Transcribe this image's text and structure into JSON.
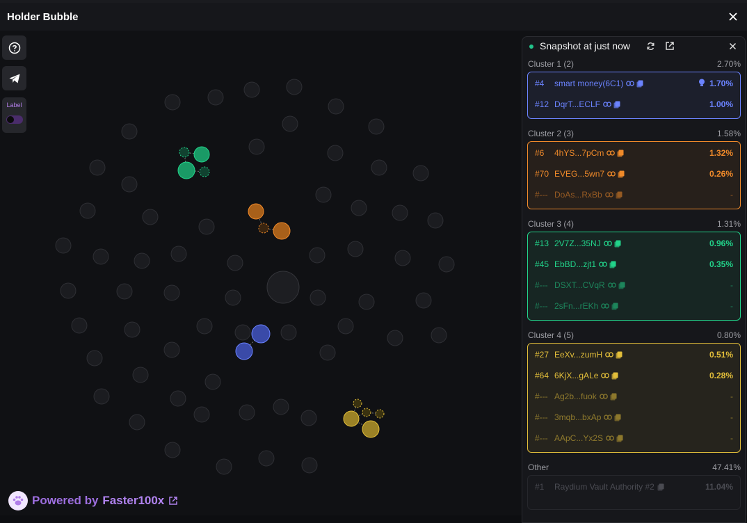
{
  "window": {
    "title": "Holder Bubble"
  },
  "left_tools": {
    "label_toggle": "Label"
  },
  "footer": {
    "powered_prefix": "Powered by",
    "brand": "Faster100x"
  },
  "panel": {
    "snapshot": "Snapshot at just now",
    "clusters": [
      {
        "name": "Cluster 1 (2)",
        "pct": "2.70%",
        "color": "#6b83ff",
        "rows": [
          {
            "rank": "#4",
            "label": "smart money(6C1)",
            "value": "1.70%",
            "bulb": true
          },
          {
            "rank": "#12",
            "label": "DqrT...ECLF",
            "value": "1.00%"
          }
        ]
      },
      {
        "name": "Cluster 2 (3)",
        "pct": "1.58%",
        "color": "#f08a2a",
        "rows": [
          {
            "rank": "#6",
            "label": "4hYS...7pCm",
            "value": "1.32%"
          },
          {
            "rank": "#70",
            "label": "EVEG...5wn7",
            "value": "0.26%"
          },
          {
            "rank": "#---",
            "label": "DoAs...RxBb",
            "value": "-"
          }
        ]
      },
      {
        "name": "Cluster 3 (4)",
        "pct": "1.31%",
        "color": "#22d38a",
        "rows": [
          {
            "rank": "#13",
            "label": "2V7Z...35NJ",
            "value": "0.96%"
          },
          {
            "rank": "#45",
            "label": "EbBD...zjt1",
            "value": "0.35%"
          },
          {
            "rank": "#---",
            "label": "DSXT...CVqR",
            "value": "-"
          },
          {
            "rank": "#---",
            "label": "2sFn...rEKh",
            "value": "-"
          }
        ]
      },
      {
        "name": "Cluster 4 (5)",
        "pct": "0.80%",
        "color": "#e2be3a",
        "rows": [
          {
            "rank": "#27",
            "label": "EeXv...zumH",
            "value": "0.51%"
          },
          {
            "rank": "#64",
            "label": "6KjX...gALe",
            "value": "0.28%"
          },
          {
            "rank": "#---",
            "label": "Ag2b...fuok",
            "value": "-"
          },
          {
            "rank": "#---",
            "label": "3mqb...bxAp",
            "value": "-"
          },
          {
            "rank": "#---",
            "label": "AApC...Yx2S",
            "value": "-"
          }
        ]
      }
    ],
    "other": {
      "name": "Other",
      "pct": "47.41%",
      "rows": [
        {
          "rank": "#1",
          "label": "Raydium Vault Authority #2",
          "value": "11.04%"
        }
      ]
    }
  },
  "colors": {
    "accent": "#9e6fe0",
    "green": "#22c48b"
  }
}
